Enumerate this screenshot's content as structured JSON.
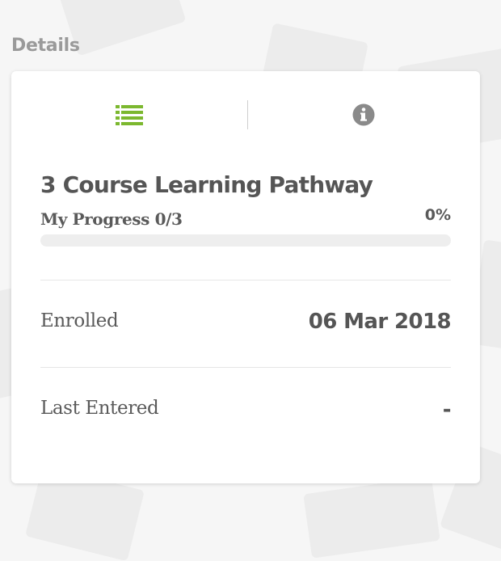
{
  "section": {
    "title": "Details"
  },
  "tabs": [
    {
      "icon": "list-icon",
      "active": true
    },
    {
      "icon": "info-icon",
      "active": false
    }
  ],
  "colors": {
    "accent": "#7cb82f",
    "inactive_icon": "#8a8a8a",
    "text": "#555555"
  },
  "pathway": {
    "title": "3 Course Learning Pathway",
    "progress_label": "My Progress 0/3",
    "progress_percent_text": "0%",
    "progress_value": 0
  },
  "details": {
    "enrolled_label": "Enrolled",
    "enrolled_value": "06 Mar 2018",
    "last_entered_label": "Last Entered",
    "last_entered_value": "-"
  }
}
